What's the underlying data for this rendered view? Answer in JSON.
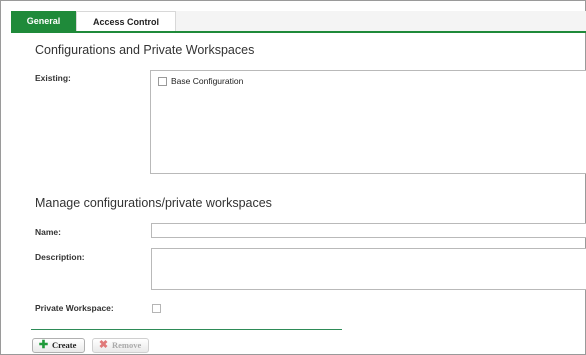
{
  "tabs": [
    {
      "label": "General"
    },
    {
      "label": "Access Control"
    }
  ],
  "sections": {
    "configs_title": "Configurations and Private Workspaces",
    "manage_title": "Manage configurations/private workspaces"
  },
  "existing": {
    "label": "Existing:",
    "items": [
      {
        "label": "Base Configuration",
        "checked": false
      }
    ]
  },
  "form": {
    "name_label": "Name:",
    "name_value": "",
    "description_label": "Description:",
    "description_value": "",
    "private_workspace_label": "Private Workspace:"
  },
  "buttons": {
    "create_label": "Create",
    "remove_label": "Remove"
  },
  "colors": {
    "accent": "#1f8a3a",
    "create_icon": "#1f9a3a",
    "remove_icon": "#e07a7a"
  },
  "icons": {
    "create": "plus-icon",
    "remove": "x-icon"
  }
}
